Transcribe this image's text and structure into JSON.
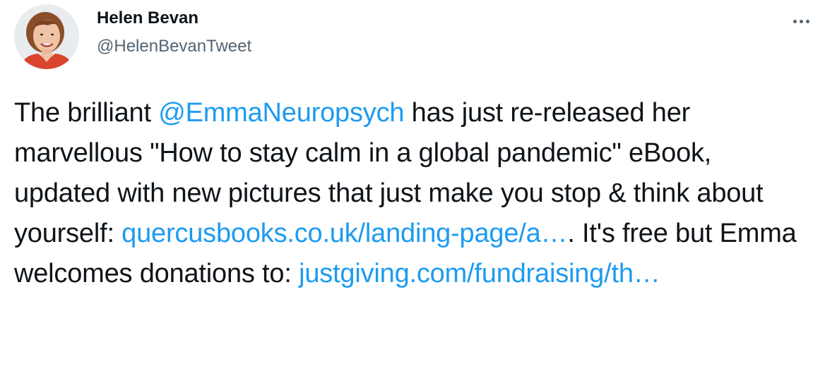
{
  "tweet": {
    "author": {
      "display_name": "Helen Bevan",
      "handle": "@HelenBevanTweet"
    },
    "more_label": "More",
    "body": {
      "part1": "The brilliant ",
      "mention": "@EmmaNeuropsych",
      "part2": " has just re-released her marvellous \"How to stay calm in a global pandemic\" eBook, updated with new pictures that just make you stop & think about yourself: ",
      "link1": "quercusbooks.co.uk/landing-page/a…",
      "part3": ". It's free but Emma welcomes donations to: ",
      "link2": "justgiving.com/fundraising/th…"
    }
  },
  "colors": {
    "text": "#0f1419",
    "secondary": "#536471",
    "link": "#1d9bf0"
  },
  "icons": {
    "more": "more-horizontal-icon",
    "avatar": "profile-photo"
  }
}
